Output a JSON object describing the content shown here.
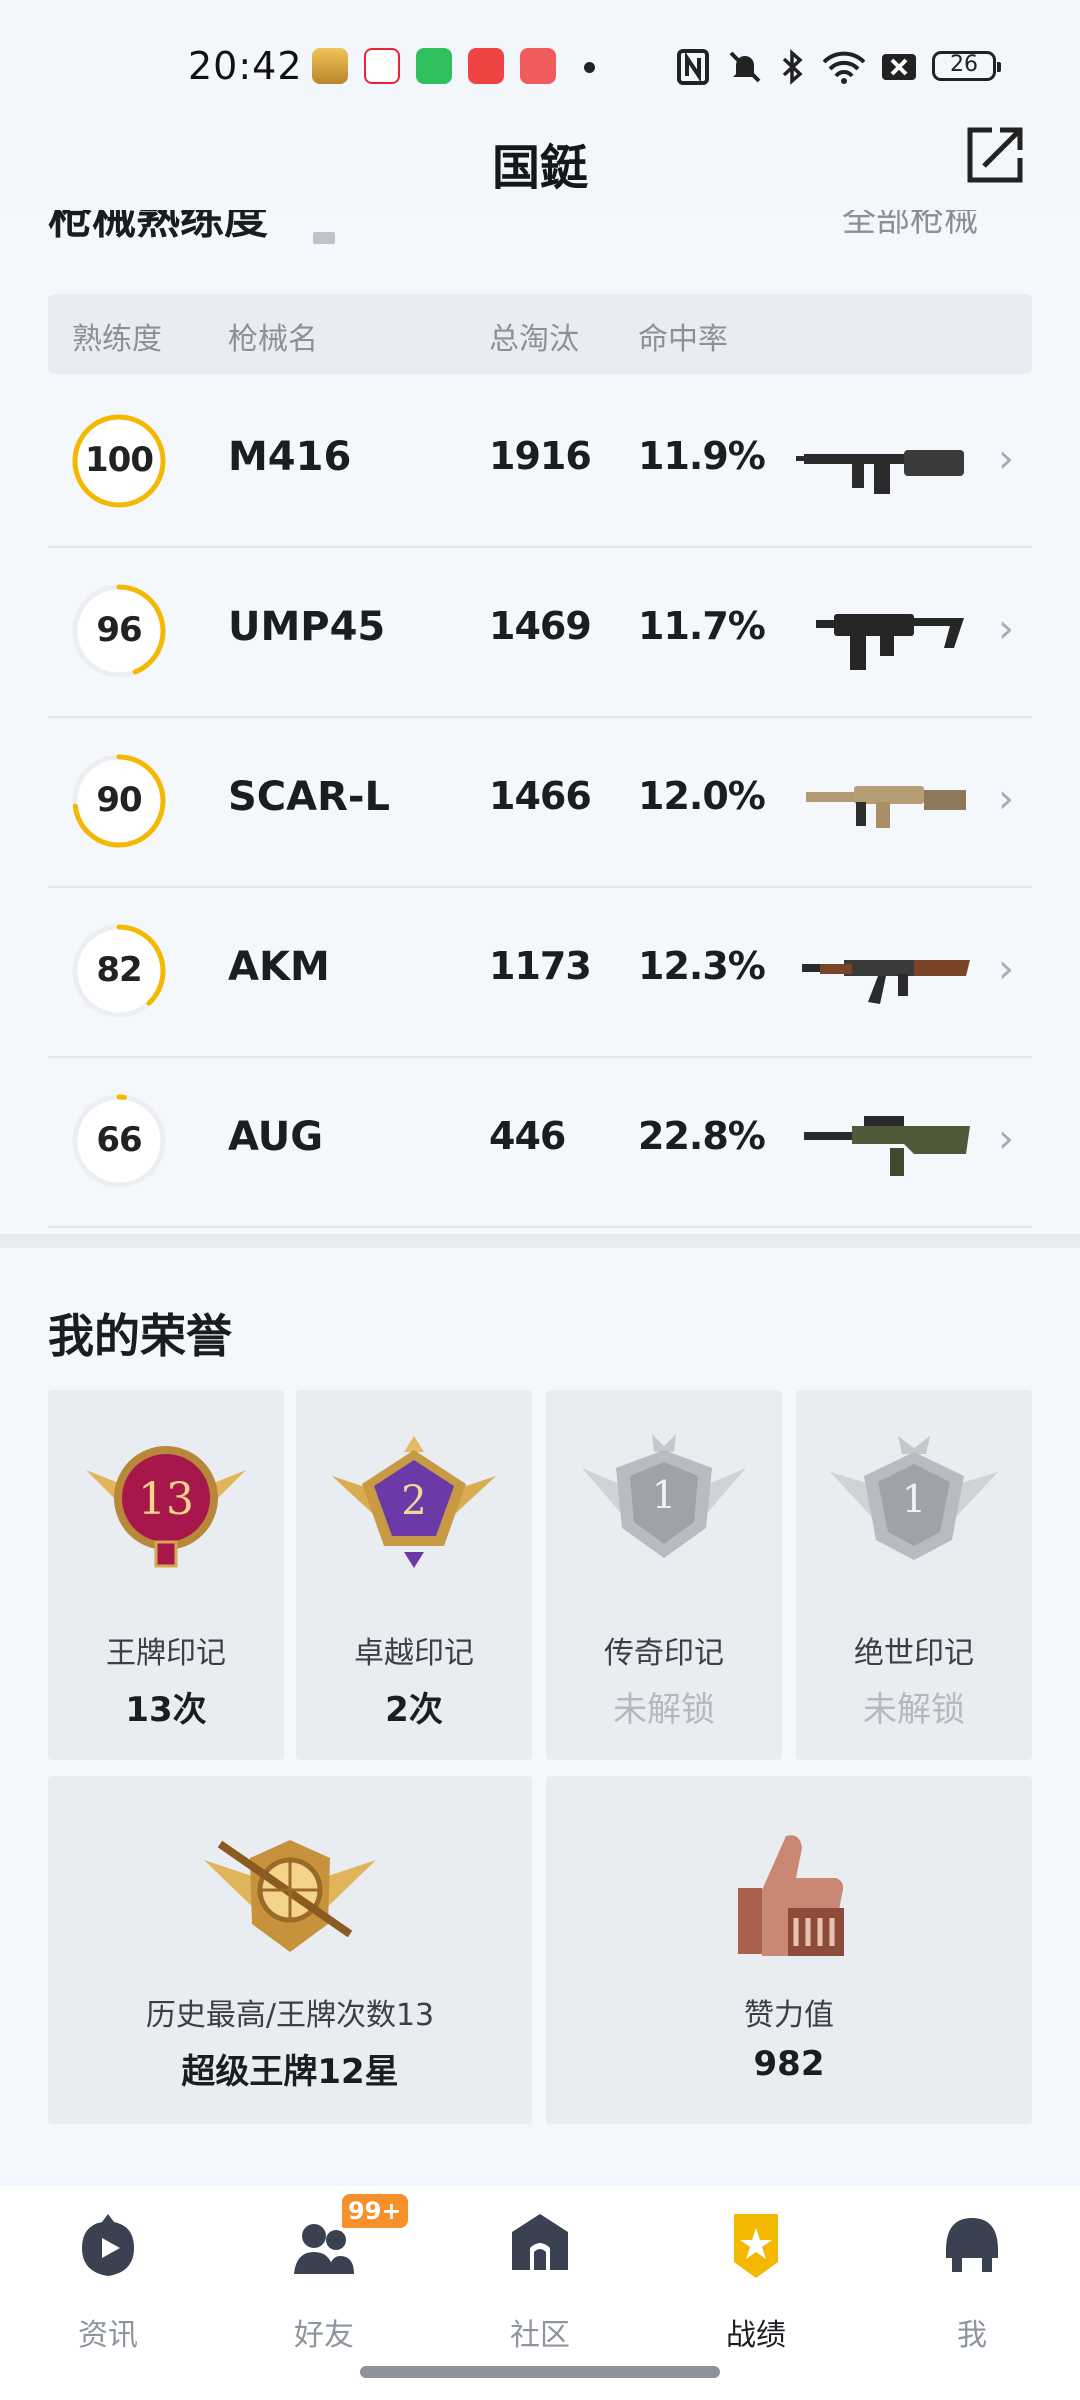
{
  "status_bar": {
    "time": "20:42",
    "battery": "26",
    "icons": [
      "app-icon-game",
      "app-icon-news",
      "app-icon-up",
      "app-icon-music",
      "app-icon-video",
      "nfc-icon",
      "mute-icon",
      "bluetooth-icon",
      "wifi-icon",
      "signal-off-icon"
    ]
  },
  "header": {
    "title": "国鋌"
  },
  "weapons": {
    "heading": "枪械熟练度",
    "all_link": "全部枪械",
    "columns": {
      "mastery": "熟练度",
      "name": "枪械名",
      "kills": "总淘汰",
      "hit_rate": "命中率"
    },
    "rows": [
      {
        "mastery": "100",
        "mastery_fraction": 1.0,
        "name": "M416",
        "kills": "1916",
        "hit_rate": "11.9%"
      },
      {
        "mastery": "96",
        "mastery_fraction": 0.44,
        "name": "UMP45",
        "kills": "1469",
        "hit_rate": "11.7%"
      },
      {
        "mastery": "90",
        "mastery_fraction": 0.73,
        "name": "SCAR-L",
        "kills": "1466",
        "hit_rate": "12.0%"
      },
      {
        "mastery": "82",
        "mastery_fraction": 0.38,
        "name": "AKM",
        "kills": "1173",
        "hit_rate": "12.3%"
      },
      {
        "mastery": "66",
        "mastery_fraction": 0.02,
        "name": "AUG",
        "kills": "446",
        "hit_rate": "22.8%"
      }
    ]
  },
  "honors": {
    "title": "我的荣誉",
    "marks": [
      {
        "name": "王牌印记",
        "value": "13次",
        "badge_number": "13",
        "locked": false
      },
      {
        "name": "卓越印记",
        "value": "2次",
        "badge_number": "2",
        "locked": false
      },
      {
        "name": "传奇印记",
        "value": "未解锁",
        "badge_number": "1",
        "locked": true
      },
      {
        "name": "绝世印记",
        "value": "未解锁",
        "badge_number": "1",
        "locked": true
      }
    ],
    "highest": {
      "label": "历史最高/王牌次数13",
      "value": "超级王牌12星"
    },
    "likes": {
      "label": "赞力值",
      "value": "982"
    }
  },
  "bottom_nav": {
    "items": [
      {
        "label": "资讯",
        "icon": "news-play-icon"
      },
      {
        "label": "好友",
        "icon": "friends-icon"
      },
      {
        "label": "社区",
        "icon": "community-icon"
      },
      {
        "label": "战绩",
        "icon": "record-badge-icon"
      },
      {
        "label": "我",
        "icon": "helmet-icon"
      }
    ],
    "active": "战绩",
    "friends_badge": "99+"
  },
  "colors": {
    "accent": "#f5b800",
    "badge": "#f5902a",
    "background": "#f3f6fb"
  }
}
